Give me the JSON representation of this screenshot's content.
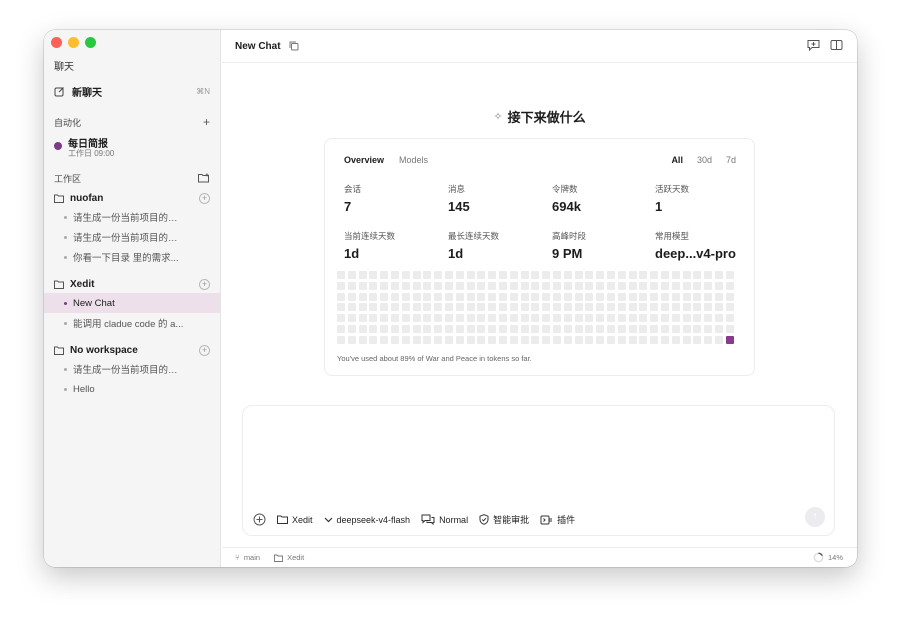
{
  "sidebar": {
    "title": "聊天",
    "new_chat": {
      "label": "新聊天",
      "shortcut": "⌘N"
    },
    "automation": {
      "section": "自动化",
      "item": {
        "title": "每日简报",
        "schedule": "工作日 09:00",
        "color": "#7e3a85"
      }
    },
    "workspace_section": "工作区",
    "workspaces": [
      {
        "name": "nuofan",
        "chats": [
          "请生成一份当前项目的晨...",
          "请生成一份当前项目的晨...",
          "你看一下目录 里的需求..."
        ]
      },
      {
        "name": "Xedit",
        "chats": [
          "New Chat",
          "能调用 cladue code 的 a..."
        ]
      },
      {
        "name": "No workspace",
        "chats": [
          "请生成一份当前项目的晨...",
          "Hello"
        ]
      }
    ]
  },
  "header": {
    "title": "New Chat"
  },
  "main": {
    "heading": "接下来做什么"
  },
  "stats": {
    "tabs": [
      "Overview",
      "Models"
    ],
    "ranges": [
      "All",
      "30d",
      "7d"
    ],
    "items": [
      {
        "label": "会话",
        "value": "7"
      },
      {
        "label": "消息",
        "value": "145"
      },
      {
        "label": "令牌数",
        "value": "694k"
      },
      {
        "label": "活跃天数",
        "value": "1"
      },
      {
        "label": "当前连续天数",
        "value": "1d"
      },
      {
        "label": "最长连续天数",
        "value": "1d"
      },
      {
        "label": "高峰时段",
        "value": "9 PM"
      },
      {
        "label": "常用模型",
        "value": "deep...v4-pro"
      }
    ],
    "heatmap": {
      "rows": 7,
      "cols": 37,
      "active_cell": {
        "row": 6,
        "col": 36
      },
      "active_color": "#8a3a8e"
    },
    "footnote": "You've used about 89% of War and Peace in tokens so far."
  },
  "composer": {
    "workspace": "Xedit",
    "model": "deepseek-v4-flash",
    "mode": "Normal",
    "review": "智能审批",
    "plugins": "插件"
  },
  "statusbar": {
    "branch": "main",
    "workspace": "Xedit",
    "usage": "14%"
  }
}
